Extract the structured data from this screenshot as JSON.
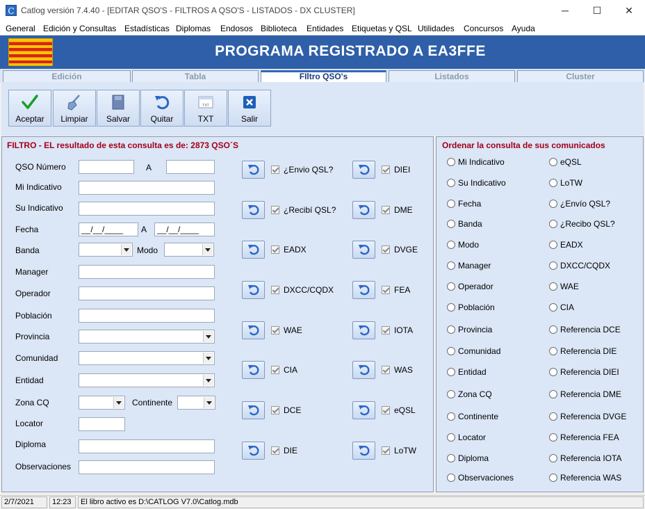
{
  "window": {
    "title": "Catlog versión 7.4.40 - [EDITAR QSO'S  - FILTROS A QSO'S - LISTADOS -  DX CLUSTER]",
    "icon_letter": "C",
    "minimize": "─",
    "maximize": "☐",
    "close": "✕"
  },
  "menu": [
    "General",
    "Edición y Consultas",
    "Estadísticas",
    "Diplomas",
    "Endosos",
    "Biblioteca",
    "Entidades",
    "Etiquetas y QSL",
    "Utilidades",
    "Concursos",
    "Ayuda"
  ],
  "banner": {
    "title": "PROGRAMA REGISTRADO A EA3FFE"
  },
  "tabs": [
    "Edición",
    "Tabla",
    "FIltro QSO's",
    "Listados",
    "Cluster"
  ],
  "active_tab": "FIltro QSO's",
  "toolbar": [
    {
      "label": "Aceptar",
      "icon": "check-icon"
    },
    {
      "label": "Limpiar",
      "icon": "broom-icon"
    },
    {
      "label": "Salvar",
      "icon": "save-icon"
    },
    {
      "label": "Quitar",
      "icon": "undo-icon"
    },
    {
      "label": "TXT",
      "icon": "txt-icon"
    },
    {
      "label": "Salir",
      "icon": "exit-icon"
    }
  ],
  "filter": {
    "title": "FILTRO - EL resultado de esta consulta es de: 2873 QSO´S",
    "labels": {
      "qso_numero": "QSO Número",
      "a": "A",
      "mi_indicativo": "Mi Indicativo",
      "su_indicativo": "Su Indicativo",
      "fecha": "Fecha",
      "banda": "Banda",
      "modo": "Modo",
      "manager": "Manager",
      "operador": "Operador",
      "poblacion": "Población",
      "provincia": "Provincia",
      "comunidad": "Comunidad",
      "entidad": "Entidad",
      "zona_cq": "Zona CQ",
      "continente": "Continente",
      "locator": "Locator",
      "diploma": "Diploma",
      "observaciones": "Observaciones"
    },
    "values": {
      "qso_from": "",
      "qso_to": "",
      "mi_indicativo": "",
      "su_indicativo": "",
      "fecha_from": "__/__/____",
      "fecha_to": "__/__/____",
      "banda": "",
      "modo": "",
      "manager": "",
      "operador": "",
      "poblacion": "",
      "provincia": "",
      "comunidad": "",
      "entidad": "",
      "zona_cq": "",
      "continente": "",
      "locator": "",
      "diploma": "",
      "observaciones": ""
    },
    "checks_left": [
      "¿Envio QSL?",
      "¿Recibí QSL?",
      "EADX",
      "DXCC/CQDX",
      "WAE",
      "CIA",
      "DCE",
      "DIE"
    ],
    "checks_right": [
      "DIEI",
      "DME",
      "DVGE",
      "FEA",
      "IOTA",
      "WAS",
      "eQSL",
      "LoTW"
    ]
  },
  "order": {
    "title": "Ordenar la consulta de sus comunicados",
    "col1": [
      "Mi Indicativo",
      "Su Indicativo",
      "Fecha",
      "Banda",
      "Modo",
      "Manager",
      "Operador",
      "Población",
      "Provincia",
      "Comunidad",
      "Entidad",
      "Zona CQ",
      "Continente",
      "Locator",
      "Diploma",
      "Observaciones"
    ],
    "col2": [
      "eQSL",
      "LoTW",
      "¿Envío QSL?",
      "¿Recibo QSL?",
      "EADX",
      "DXCC/CQDX",
      "WAE",
      "CIA",
      "Referencia DCE",
      "Referencia DIE",
      "Referencia DIEI",
      "Referencia DME",
      "Referencia DVGE",
      "Referencia FEA",
      "Referencia IOTA",
      "Referencia WAS"
    ]
  },
  "status": {
    "date": "2/7/2021",
    "time": "12:23",
    "message": "El libro activo es D:\\CATLOG V7.0\\Catlog.mdb"
  },
  "colors": {
    "banner": "#2f5fa8",
    "panel": "#dbe6f6",
    "title_red": "#a3001a"
  }
}
